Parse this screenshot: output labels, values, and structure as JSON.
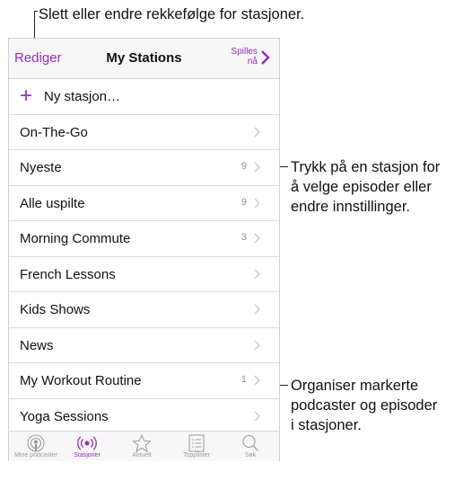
{
  "callouts": {
    "top": "Slett eller endre rekkefølge for stasjoner.",
    "middle": [
      "Trykk på en stasjon for",
      "å velge episoder eller",
      "endre innstillinger."
    ],
    "bottom": [
      "Organiser markerte",
      "podcaster og episoder",
      "i stasjoner."
    ]
  },
  "navbar": {
    "edit_label": "Rediger",
    "title": "My Stations",
    "play_now_line1": "Spilles",
    "play_now_line2": "nå"
  },
  "new_station_label": "Ny stasjon…",
  "stations": [
    {
      "name": "On-The-Go",
      "count": ""
    },
    {
      "name": "Nyeste",
      "count": "9"
    },
    {
      "name": "Alle uspilte",
      "count": "9"
    },
    {
      "name": "Morning Commute",
      "count": "3"
    },
    {
      "name": "French Lessons",
      "count": ""
    },
    {
      "name": "Kids Shows",
      "count": ""
    },
    {
      "name": "News",
      "count": ""
    },
    {
      "name": "My Workout Routine",
      "count": "1"
    },
    {
      "name": "Yoga Sessions",
      "count": ""
    }
  ],
  "tabs": [
    {
      "label": "Mine podcaster",
      "icon": "podcast-icon"
    },
    {
      "label": "Stasjoner",
      "icon": "stations-icon"
    },
    {
      "label": "Aktuelt",
      "icon": "star-icon"
    },
    {
      "label": "Topplister",
      "icon": "list-icon"
    },
    {
      "label": "Søk",
      "icon": "search-icon"
    }
  ],
  "colors": {
    "accent": "#9b2bbf",
    "separator": "#dcdcdc",
    "count": "#8e8e93"
  }
}
